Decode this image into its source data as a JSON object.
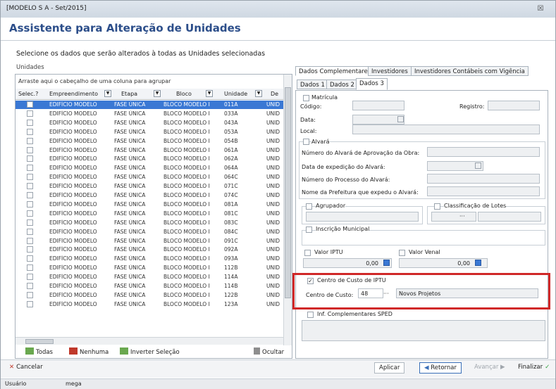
{
  "window": {
    "title": "[MODELO S A - Set/2015]",
    "close_glyph": "☒"
  },
  "heading": "Assistente para Alteração de Unidades",
  "subtitle": "Selecione os dados que serão alterados à todas as Unidades selecionadas",
  "units_group_label": "Unidades",
  "grid": {
    "drag_hint": "Arraste aqui o cabeçalho de uma coluna para agrupar",
    "columns": [
      "Selec.?",
      "Empreendimento",
      "Etapa",
      "Bloco",
      "Unidade",
      "De"
    ],
    "rows": [
      {
        "emp": "EDIFÍCIO MODELO",
        "etapa": "FASE ÚNICA",
        "bloco": "BLOCO MODELO I",
        "unidade": "011A",
        "de": "UNID"
      },
      {
        "emp": "EDIFÍCIO MODELO",
        "etapa": "FASE ÚNICA",
        "bloco": "BLOCO MODELO I",
        "unidade": "033A",
        "de": "UNID"
      },
      {
        "emp": "EDIFÍCIO MODELO",
        "etapa": "FASE ÚNICA",
        "bloco": "BLOCO MODELO I",
        "unidade": "043A",
        "de": "UNID"
      },
      {
        "emp": "EDIFÍCIO MODELO",
        "etapa": "FASE ÚNICA",
        "bloco": "BLOCO MODELO I",
        "unidade": "053A",
        "de": "UNID"
      },
      {
        "emp": "EDIFÍCIO MODELO",
        "etapa": "FASE ÚNICA",
        "bloco": "BLOCO MODELO I",
        "unidade": "054B",
        "de": "UNID"
      },
      {
        "emp": "EDIFÍCIO MODELO",
        "etapa": "FASE ÚNICA",
        "bloco": "BLOCO MODELO I",
        "unidade": "061A",
        "de": "UNID"
      },
      {
        "emp": "EDIFÍCIO MODELO",
        "etapa": "FASE ÚNICA",
        "bloco": "BLOCO MODELO I",
        "unidade": "062A",
        "de": "UNID"
      },
      {
        "emp": "EDIFÍCIO MODELO",
        "etapa": "FASE ÚNICA",
        "bloco": "BLOCO MODELO I",
        "unidade": "064A",
        "de": "UNID"
      },
      {
        "emp": "EDIFÍCIO MODELO",
        "etapa": "FASE ÚNICA",
        "bloco": "BLOCO MODELO I",
        "unidade": "064C",
        "de": "UNID"
      },
      {
        "emp": "EDIFÍCIO MODELO",
        "etapa": "FASE ÚNICA",
        "bloco": "BLOCO MODELO I",
        "unidade": "071C",
        "de": "UNID"
      },
      {
        "emp": "EDIFÍCIO MODELO",
        "etapa": "FASE ÚNICA",
        "bloco": "BLOCO MODELO I",
        "unidade": "074C",
        "de": "UNID"
      },
      {
        "emp": "EDIFÍCIO MODELO",
        "etapa": "FASE ÚNICA",
        "bloco": "BLOCO MODELO I",
        "unidade": "081A",
        "de": "UNID"
      },
      {
        "emp": "EDIFÍCIO MODELO",
        "etapa": "FASE ÚNICA",
        "bloco": "BLOCO MODELO I",
        "unidade": "081C",
        "de": "UNID"
      },
      {
        "emp": "EDIFÍCIO MODELO",
        "etapa": "FASE ÚNICA",
        "bloco": "BLOCO MODELO I",
        "unidade": "083C",
        "de": "UNID"
      },
      {
        "emp": "EDIFÍCIO MODELO",
        "etapa": "FASE ÚNICA",
        "bloco": "BLOCO MODELO I",
        "unidade": "084C",
        "de": "UNID"
      },
      {
        "emp": "EDIFÍCIO MODELO",
        "etapa": "FASE ÚNICA",
        "bloco": "BLOCO MODELO I",
        "unidade": "091C",
        "de": "UNID"
      },
      {
        "emp": "EDIFÍCIO MODELO",
        "etapa": "FASE ÚNICA",
        "bloco": "BLOCO MODELO I",
        "unidade": "092A",
        "de": "UNID"
      },
      {
        "emp": "EDIFÍCIO MODELO",
        "etapa": "FASE ÚNICA",
        "bloco": "BLOCO MODELO I",
        "unidade": "093A",
        "de": "UNID"
      },
      {
        "emp": "EDIFÍCIO MODELO",
        "etapa": "FASE ÚNICA",
        "bloco": "BLOCO MODELO I",
        "unidade": "112B",
        "de": "UNID"
      },
      {
        "emp": "EDIFÍCIO MODELO",
        "etapa": "FASE ÚNICA",
        "bloco": "BLOCO MODELO I",
        "unidade": "114A",
        "de": "UNID"
      },
      {
        "emp": "EDIFÍCIO MODELO",
        "etapa": "FASE ÚNICA",
        "bloco": "BLOCO MODELO I",
        "unidade": "114B",
        "de": "UNID"
      },
      {
        "emp": "EDIFÍCIO MODELO",
        "etapa": "FASE ÚNICA",
        "bloco": "BLOCO MODELO I",
        "unidade": "122B",
        "de": "UNID"
      },
      {
        "emp": "EDIFÍCIO MODELO",
        "etapa": "FASE ÚNICA",
        "bloco": "BLOCO MODELO I",
        "unidade": "123A",
        "de": "UNID"
      }
    ],
    "buttons": {
      "todas": "Todas",
      "nenhuma": "Nenhuma",
      "inverter": "Inverter Seleção",
      "ocultar": "Ocultar"
    }
  },
  "tabs_top": [
    "Dados Complementares",
    "Investidores",
    "Investidores Contábeis com Vigência"
  ],
  "tabs_sub": [
    "Dados 1",
    "Dados 2",
    "Dados 3"
  ],
  "form": {
    "matricula": "Matrícula",
    "codigo": "Código:",
    "registro": "Registro:",
    "data": "Data:",
    "local": "Local:",
    "alvara": "Alvará",
    "num_alvara": "Número do Alvará de Aprovação da Obra:",
    "data_exp": "Data de expedição do Alvará:",
    "num_processo": "Número do Processo do Alvará:",
    "prefeitura": "Nome da Prefeitura que expedu o Alvará:",
    "agrupador": "Agrupador",
    "class_lotes": "Classificação de Lotes",
    "insc_municipal": "Inscrição Municipal",
    "valor_iptu": "Valor IPTU",
    "valor_iptu_val": "0,00",
    "valor_venal": "Valor Venal",
    "valor_venal_val": "0,00",
    "centro_custo_iptu": "Centro de Custo de IPTU",
    "centro_custo_label": "Centro de Custo:",
    "centro_custo_code": "48",
    "centro_custo_dots": "···",
    "centro_custo_name": "Novos Projetos",
    "inf_sped": "Inf. Complementares SPED"
  },
  "footer": {
    "cancelar": "Cancelar",
    "aplicar": "Aplicar",
    "retornar": "Retornar",
    "avancar": "Avançar",
    "finalizar": "Finalizar"
  },
  "status": {
    "label": "Usuário",
    "value": "mega"
  },
  "colors": {
    "title": "#2c4e8a",
    "selection": "#3a78d4",
    "highlight": "#d02828"
  }
}
